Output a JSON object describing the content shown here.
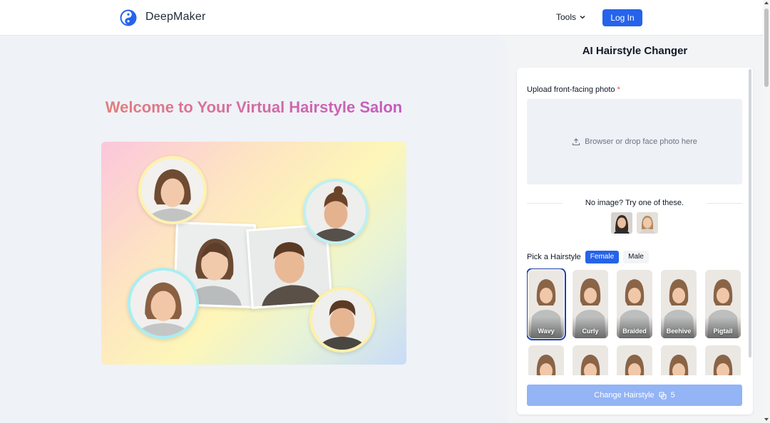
{
  "header": {
    "brand": "DeepMaker",
    "tools_label": "Tools",
    "login_label": "Log In"
  },
  "hero": {
    "title": "Welcome to Your Virtual Hairstyle Salon"
  },
  "panel": {
    "title": "AI Hairstyle Changer",
    "upload_label": "Upload front-facing photo",
    "required_mark": "*",
    "dropzone_text": "Browser or drop face photo here",
    "samples_text": "No image? Try one of these.",
    "pick_label": "Pick a Hairstyle",
    "gender_options": [
      "Female",
      "Male"
    ],
    "selected_gender": "Female",
    "hairstyles": [
      {
        "label": "Wavy",
        "selected": true
      },
      {
        "label": "Curly",
        "selected": false
      },
      {
        "label": "Braided",
        "selected": false
      },
      {
        "label": "Beehive",
        "selected": false
      },
      {
        "label": "Pigtail",
        "selected": false
      }
    ],
    "cta_label": "Change Hairstyle",
    "cta_cost": "5"
  },
  "colors": {
    "accent": "#2563eb",
    "cta_disabled": "#93b4f5",
    "required": "#ef4444"
  }
}
